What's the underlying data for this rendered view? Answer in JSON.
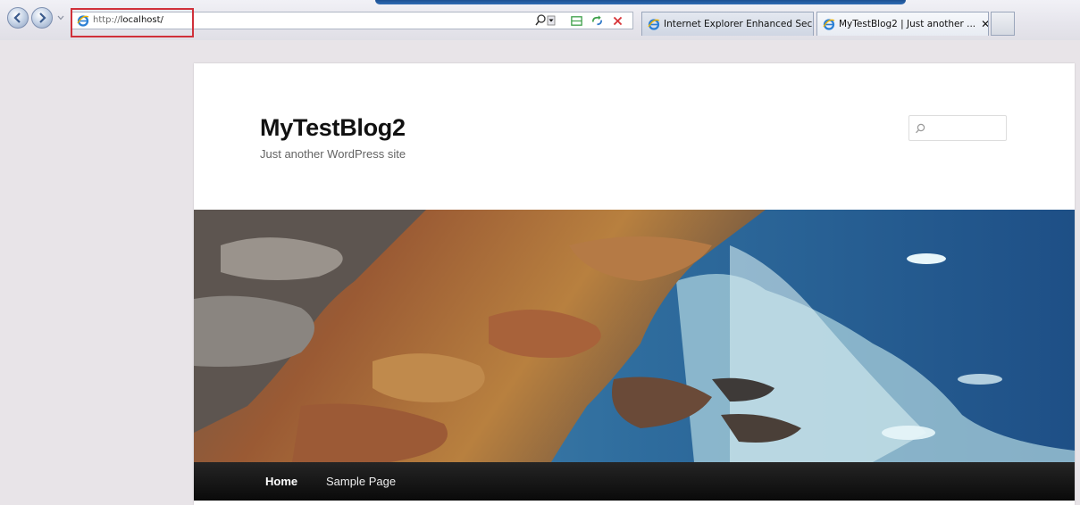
{
  "browser": {
    "address_url_prefix": "http://",
    "address_url_host": "localhost/",
    "tabs": [
      {
        "label": "Internet Explorer Enhanced Sec...",
        "active": false
      },
      {
        "label": "MyTestBlog2 | Just another ...",
        "active": true
      }
    ],
    "tab_close_glyph": "✕",
    "highlight_color": "#d0303a"
  },
  "site": {
    "title": "MyTestBlog2",
    "description": "Just another WordPress site",
    "search_placeholder": ""
  },
  "menu": {
    "items": [
      {
        "label": "Home",
        "current": true
      },
      {
        "label": "Sample Page",
        "current": false
      }
    ]
  },
  "icons": {
    "back": "back-arrow-icon",
    "forward": "forward-arrow-icon",
    "site": "ie-logo-icon",
    "search": "magnifier-icon",
    "compat": "compatibility-view-icon",
    "refresh": "refresh-icon",
    "stop": "stop-icon"
  }
}
